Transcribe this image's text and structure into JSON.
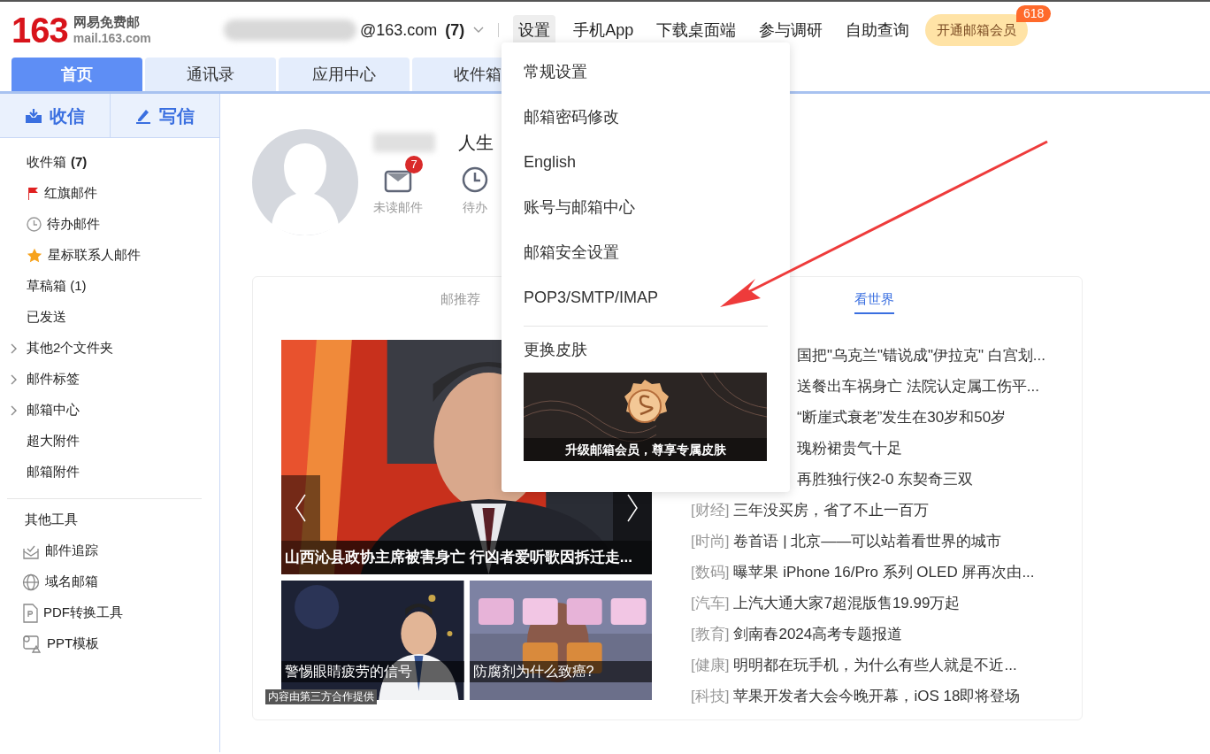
{
  "logo": {
    "number": "163",
    "name": "网易免费邮",
    "domain": "mail.163.com"
  },
  "account": {
    "address": "@163.com",
    "count": "(7)"
  },
  "nav": [
    {
      "label": "设置",
      "selected": true
    },
    {
      "label": "手机App",
      "selected": false
    },
    {
      "label": "下载桌面端",
      "selected": false
    },
    {
      "label": "参与调研",
      "selected": false
    },
    {
      "label": "自助查询",
      "selected": false
    }
  ],
  "vip": {
    "label": "开通邮箱会员",
    "badge": "618"
  },
  "tabs": [
    {
      "label": "首页",
      "selected": true
    },
    {
      "label": "通讯录",
      "selected": false
    },
    {
      "label": "应用中心",
      "selected": false
    },
    {
      "label": "收件箱",
      "selected": false
    }
  ],
  "sidebar": {
    "receive": "收信",
    "compose": "写信",
    "folders": [
      {
        "label": "收件箱",
        "count": "(7)",
        "kind": "plain"
      },
      {
        "label": "红旗邮件",
        "kind": "flag"
      },
      {
        "label": "待办邮件",
        "kind": "clock"
      },
      {
        "label": "星标联系人邮件",
        "kind": "star"
      },
      {
        "label": "草稿箱 (1)",
        "kind": "plain"
      },
      {
        "label": "已发送",
        "kind": "plain"
      },
      {
        "label": "其他2个文件夹",
        "kind": "expandable"
      },
      {
        "label": "邮件标签",
        "kind": "expandable"
      },
      {
        "label": "邮箱中心",
        "kind": "expandable"
      },
      {
        "label": "超大附件",
        "kind": "plain"
      },
      {
        "label": "邮箱附件",
        "kind": "plain"
      }
    ],
    "tools_title": "其他工具",
    "tools": [
      {
        "label": "邮件追踪",
        "kind": "track"
      },
      {
        "label": "域名邮箱",
        "kind": "globe"
      },
      {
        "label": "PDF转换工具",
        "kind": "pdf"
      },
      {
        "label": "PPT模板",
        "kind": "ppt"
      }
    ]
  },
  "profile": {
    "name": "人生",
    "stats": [
      {
        "label": "未读邮件",
        "badge": "7",
        "kind": "mail"
      },
      {
        "label": "待办",
        "kind": "clock"
      }
    ]
  },
  "panel": {
    "tabs": [
      {
        "label": "邮推荐",
        "selected": false
      },
      {
        "label": "看世界",
        "selected": true
      }
    ],
    "headline": "山西沁县政协主席被害身亡 行凶者爱听歌因拆迁走...",
    "thumbs": [
      {
        "caption": "警惕眼睛疲劳的信号"
      },
      {
        "caption": "防腐剂为什么致癌?"
      }
    ],
    "source": "内容由第三方合作提供",
    "news": [
      {
        "kind": "partial",
        "title": "国把\"乌克兰\"错说成\"伊拉克\" 白宫划..."
      },
      {
        "kind": "partial",
        "title": "送餐出车祸身亡 法院认定属工伤平..."
      },
      {
        "kind": "partial",
        "title": "“断崖式衰老”发生在30岁和50岁"
      },
      {
        "kind": "partial",
        "title": "瑰粉裙贵气十足"
      },
      {
        "kind": "partial",
        "title": "再胜独行侠2-0 东契奇三双"
      },
      {
        "kind": "full",
        "category": "[财经]",
        "title": "三年没买房，省了不止一百万"
      },
      {
        "kind": "full",
        "category": "[时尚]",
        "title": "卷首语 | 北京——可以站着看世界的城市"
      },
      {
        "kind": "full",
        "category": "[数码]",
        "title": "曝苹果 iPhone 16/Pro 系列 OLED 屏再次由..."
      },
      {
        "kind": "full",
        "category": "[汽车]",
        "title": "上汽大通大家7超混版售19.99万起"
      },
      {
        "kind": "full",
        "category": "[教育]",
        "title": "剑南春2024高考专题报道"
      },
      {
        "kind": "full",
        "category": "[健康]",
        "title": "明明都在玩手机，为什么有些人就是不近..."
      },
      {
        "kind": "full",
        "category": "[科技]",
        "title": "苹果开发者大会今晚开幕，iOS 18即将登场"
      }
    ]
  },
  "menu": {
    "items": [
      "常规设置",
      "邮箱密码修改",
      "English",
      "账号与邮箱中心",
      "邮箱安全设置",
      "POP3/SMTP/IMAP"
    ],
    "skin": "更换皮肤",
    "banner": "升级邮箱会员，尊享专属皮肤"
  }
}
